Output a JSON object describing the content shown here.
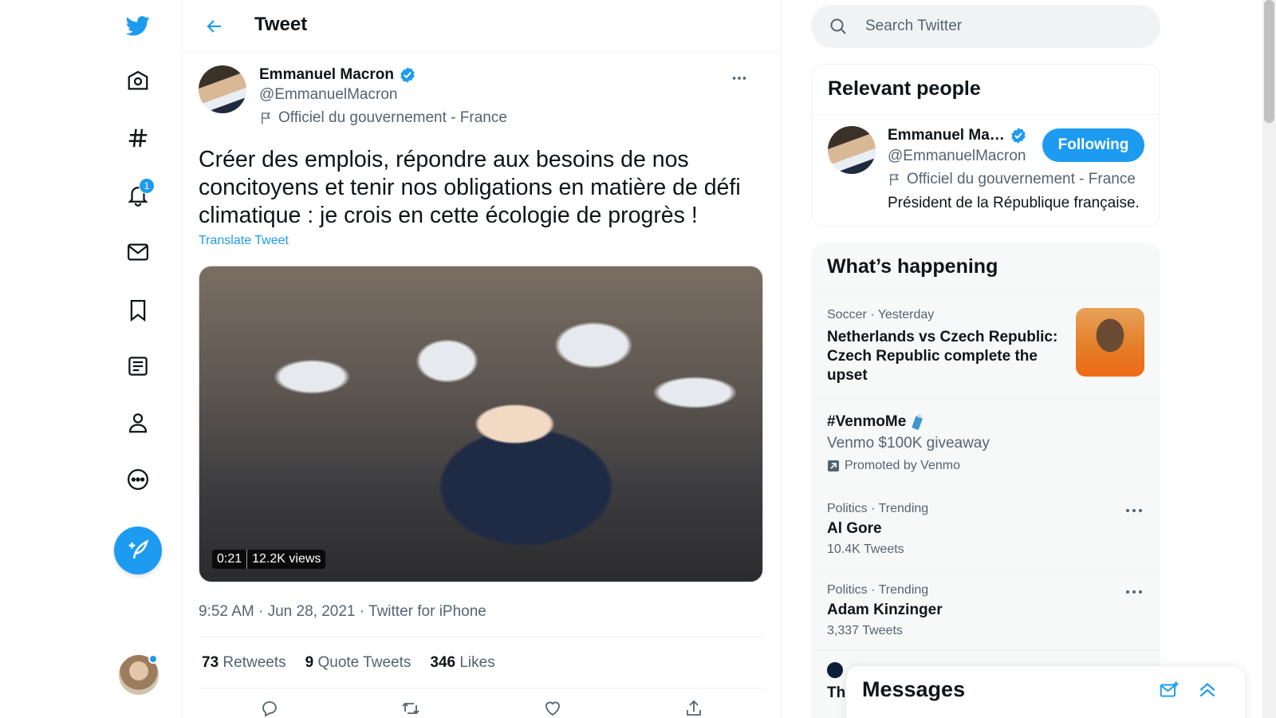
{
  "colors": {
    "accent": "#1d9bf0",
    "text": "#0f1419",
    "muted": "#536471",
    "border": "#eff3f4"
  },
  "nav": {
    "items": [
      {
        "icon": "twitter-bird-icon"
      },
      {
        "icon": "home-icon"
      },
      {
        "icon": "hashtag-icon"
      },
      {
        "icon": "bell-icon",
        "badge": "1"
      },
      {
        "icon": "mail-icon"
      },
      {
        "icon": "bookmark-icon"
      },
      {
        "icon": "list-icon"
      },
      {
        "icon": "profile-icon"
      },
      {
        "icon": "more-circle-icon"
      }
    ]
  },
  "header": {
    "title": "Tweet"
  },
  "tweet": {
    "name": "Emmanuel Macron",
    "handle": "@EmmanuelMacron",
    "label": "Officiel du gouvernement - France",
    "text": "Créer des emplois, répondre aux besoins de nos concitoyens et tenir nos obligations en matière de défi climatique : je crois en cette écologie de progrès !",
    "translate": "Translate Tweet",
    "video": {
      "duration": "0:21",
      "views": "12.2K views"
    },
    "time": "9:52 AM · Jun 28, 2021 · ",
    "source": "Twitter for iPhone",
    "stats": [
      {
        "count": "73",
        "label": "Retweets"
      },
      {
        "count": "9",
        "label": "Quote Tweets"
      },
      {
        "count": "346",
        "label": "Likes"
      }
    ]
  },
  "search": {
    "placeholder": "Search Twitter"
  },
  "relevant": {
    "title": "Relevant people",
    "name": "Emmanuel Ma…",
    "handle": "@EmmanuelMacron",
    "label": "Officiel du gouvernement - France",
    "bio": "Président de la République française.",
    "button": "Following"
  },
  "happening": {
    "title": "What’s happening",
    "trends": [
      {
        "meta": "Soccer · Yesterday",
        "title": "Netherlands vs Czech Republic: Czech Republic complete the upset"
      },
      {
        "title": "#VenmoMe",
        "sub": "Venmo $100K giveaway",
        "promoted": "Promoted by Venmo"
      },
      {
        "meta": "Politics · Trending",
        "title": "Al Gore",
        "sub": "10.4K Tweets"
      },
      {
        "meta": "Politics · Trending",
        "title": "Adam Kinzinger",
        "sub": "3,337 Tweets"
      },
      {
        "title": "Th"
      }
    ]
  },
  "messages": {
    "title": "Messages"
  }
}
